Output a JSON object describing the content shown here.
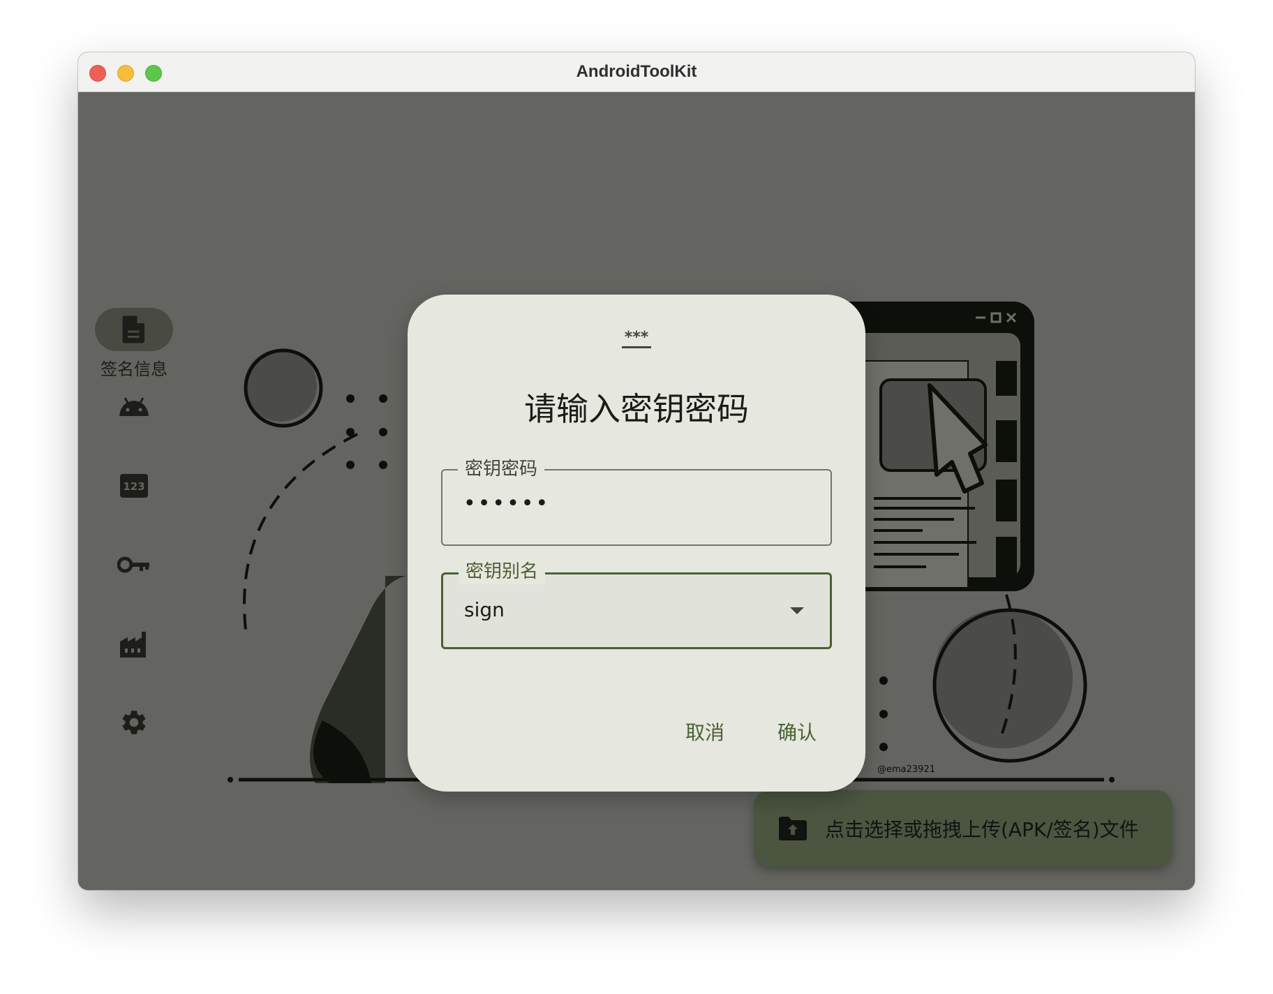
{
  "window": {
    "title": "AndroidToolKit"
  },
  "sidebar": {
    "items": [
      {
        "label": "签名信息",
        "icon": "file-document-icon",
        "active": true
      },
      {
        "label": "",
        "icon": "android-icon",
        "active": false
      },
      {
        "label": "",
        "icon": "numeric-123-icon",
        "active": false
      },
      {
        "label": "",
        "icon": "key-icon",
        "active": false
      },
      {
        "label": "",
        "icon": "factory-icon",
        "active": false
      },
      {
        "label": "",
        "icon": "gear-icon",
        "active": false
      }
    ]
  },
  "illustration": {
    "credit": "@ema23921"
  },
  "dialog": {
    "icon": "password-icon",
    "icon_text": "***",
    "title": "请输入密钥密码",
    "password_field": {
      "label": "密钥密码",
      "value": "••••••"
    },
    "alias_field": {
      "label": "密钥别名",
      "value": "sign"
    },
    "cancel_label": "取消",
    "confirm_label": "确认"
  },
  "upload": {
    "label": "点击选择或拖拽上传(APK/签名)文件",
    "icon": "folder-upload-icon"
  },
  "colors": {
    "accent": "#4a6132",
    "dialog_bg": "#e6e7df",
    "scrim_bg": "#646560",
    "upload_bg": "#4c5540"
  }
}
